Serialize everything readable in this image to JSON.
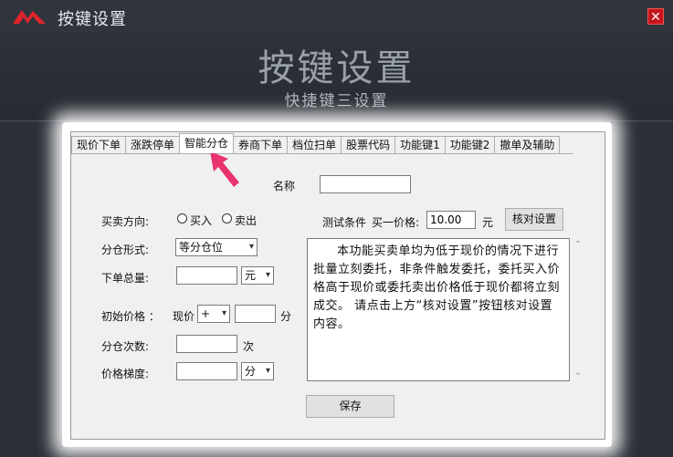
{
  "window": {
    "title": "按键设置",
    "close_icon": "✕"
  },
  "header": {
    "title": "按键设置",
    "subtitle": "快捷键三设置"
  },
  "tabs": [
    {
      "label": "现价下单"
    },
    {
      "label": "涨跌停单"
    },
    {
      "label": "智能分仓",
      "active": true
    },
    {
      "label": "券商下单"
    },
    {
      "label": "档位扫单"
    },
    {
      "label": "股票代码"
    },
    {
      "label": "功能键1"
    },
    {
      "label": "功能键2"
    },
    {
      "label": "撤单及辅助"
    }
  ],
  "form": {
    "name_label": "名称",
    "name_value": "",
    "direction_label": "买卖方向:",
    "buy_label": "买入",
    "sell_label": "卖出",
    "split_form_label": "分仓形式:",
    "split_form_value": "等分仓位",
    "total_label": "下单总量:",
    "total_value": "",
    "total_unit": "元",
    "initial_price_label": "初始价格 ：",
    "initial_price_base": "现价",
    "initial_price_op": "+",
    "initial_price_value": "",
    "initial_price_unit": "分",
    "split_count_label": "分仓次数:",
    "split_count_value": "",
    "split_count_unit": "次",
    "step_label": "价格梯度:",
    "step_value": "",
    "step_unit": "分",
    "test_condition_label": "测试条件",
    "test_price_label": "买一价格:",
    "test_price_value": "10.00",
    "test_price_unit": "元",
    "verify_button": "核对设置",
    "description": "本功能买卖单均为低于现价的情况下进行批量立刻委托，非条件触发委托，委托买入价格高于现价或委托卖出价格低于现价都将立刻成交。 请点击上方“核对设置”按钮核对设置内容。",
    "save_button": "保存"
  },
  "colors": {
    "accent": "#e8336d",
    "close": "#c4151c",
    "logo": "#e0242b"
  }
}
